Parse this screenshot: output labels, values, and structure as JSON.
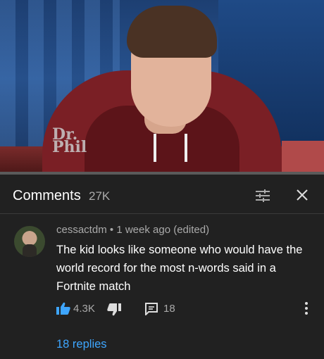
{
  "video": {
    "watermark_line1": "Dr.",
    "watermark_line2": "Phil",
    "progress_fraction": 0.0
  },
  "comments_panel": {
    "title": "Comments",
    "count": "27K",
    "sort_icon": "sort-filter-icon",
    "close_icon": "close-icon"
  },
  "comment": {
    "author": "cessactdm",
    "separator": "•",
    "time": "1 week ago (edited)",
    "text": "The kid looks like someone who would have the world record for the most n-words said in a Fortnite match",
    "likes": "4.3K",
    "replies_count": "18",
    "replies_link": "18 replies"
  },
  "colors": {
    "background": "#212121",
    "link": "#3ea6ff",
    "like_active": "#3ea6ff",
    "secondary_text": "#aaaaaa",
    "progress": "#ff0000"
  }
}
